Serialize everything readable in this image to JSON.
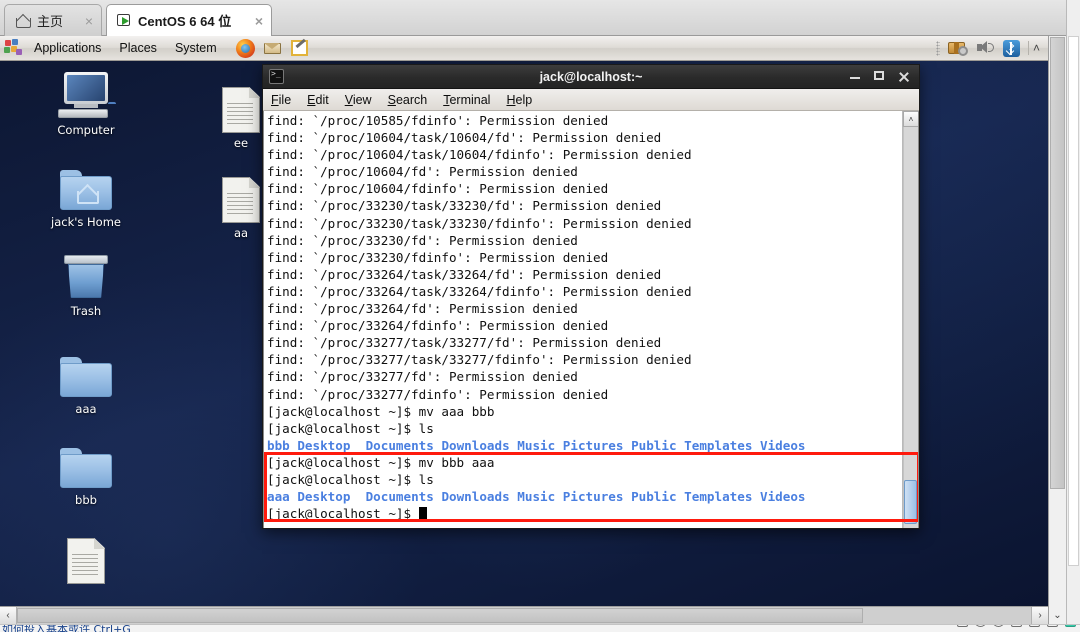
{
  "vm": {
    "tabs": [
      {
        "label": "主页",
        "icon": "home-icon",
        "close": "×",
        "active": false
      },
      {
        "label": "CentOS 6 64 位",
        "icon": "vm-screen-icon",
        "close": "×",
        "active": true
      }
    ],
    "status_text": "如何投入基本或许 Ctrl+G",
    "hscroll": {
      "left_arrow": "‹",
      "right_arrow": "›"
    },
    "vscroll": {
      "down_arrow": "⌄"
    }
  },
  "panel": {
    "logo": "gnome-foot-icon",
    "menus": [
      "Applications",
      "Places",
      "System"
    ],
    "launchers": [
      "firefox-icon",
      "email-icon",
      "text-editor-icon"
    ],
    "tray": [
      "package-updater-icon",
      "volume-icon",
      "bluetooth-icon"
    ],
    "tray_chevron": "˄"
  },
  "desktop": {
    "icons": [
      {
        "label": "Computer",
        "type": "computer",
        "col": 0,
        "row": 0
      },
      {
        "label": "jack's Home",
        "type": "home",
        "col": 0,
        "row": 1
      },
      {
        "label": "Trash",
        "type": "trash",
        "col": 0,
        "row": 2
      },
      {
        "label": "aaa",
        "type": "folder",
        "col": 0,
        "row": 3
      },
      {
        "label": "bbb",
        "type": "folder",
        "col": 0,
        "row": 4
      },
      {
        "label": "",
        "type": "document",
        "col": 0,
        "row": 5
      },
      {
        "label": "ee",
        "type": "document",
        "col": 1,
        "row": 0
      },
      {
        "label": "aa",
        "type": "document",
        "col": 1,
        "row": 1
      }
    ]
  },
  "terminal": {
    "title": "jack@localhost:~",
    "window_buttons": {
      "minimize": "minimize-button",
      "maximize": "maximize-button",
      "close": "close-button"
    },
    "menu": [
      "File",
      "Edit",
      "View",
      "Search",
      "Terminal",
      "Help"
    ],
    "prompt": "[jack@localhost ~]$ ",
    "lines": [
      "find: `/proc/10585/fdinfo': Permission denied",
      "find: `/proc/10604/task/10604/fd': Permission denied",
      "find: `/proc/10604/task/10604/fdinfo': Permission denied",
      "find: `/proc/10604/fd': Permission denied",
      "find: `/proc/10604/fdinfo': Permission denied",
      "find: `/proc/33230/task/33230/fd': Permission denied",
      "find: `/proc/33230/task/33230/fdinfo': Permission denied",
      "find: `/proc/33230/fd': Permission denied",
      "find: `/proc/33230/fdinfo': Permission denied",
      "find: `/proc/33264/task/33264/fd': Permission denied",
      "find: `/proc/33264/task/33264/fdinfo': Permission denied",
      "find: `/proc/33264/fd': Permission denied",
      "find: `/proc/33264/fdinfo': Permission denied",
      "find: `/proc/33277/task/33277/fd': Permission denied",
      "find: `/proc/33277/task/33277/fdinfo': Permission denied",
      "find: `/proc/33277/fd': Permission denied",
      "find: `/proc/33277/fdinfo': Permission denied"
    ],
    "commands": [
      {
        "prompt": "[jack@localhost ~]$ ",
        "cmd": "mv aaa bbb"
      },
      {
        "prompt": "[jack@localhost ~]$ ",
        "cmd": "ls"
      }
    ],
    "ls_output_1": [
      "bbb",
      "Desktop",
      "Documents",
      "Downloads",
      "Music",
      "Pictures",
      "Public",
      "Templates",
      "Videos"
    ],
    "highlighted_commands": [
      {
        "prompt": "[jack@localhost ~]$ ",
        "cmd": "mv bbb aaa"
      },
      {
        "prompt": "[jack@localhost ~]$ ",
        "cmd": "ls"
      }
    ],
    "ls_output_2": [
      "aaa",
      "Desktop",
      "Documents",
      "Downloads",
      "Music",
      "Pictures",
      "Public",
      "Templates",
      "Videos"
    ],
    "final_prompt": "[jack@localhost ~]$ ",
    "scrollbar": {
      "up_arrow": "˄"
    },
    "colors": {
      "dir": "#4a7fe0",
      "text": "#111111",
      "background": "#ffffff",
      "highlight_box": "#ff1a0d"
    }
  }
}
